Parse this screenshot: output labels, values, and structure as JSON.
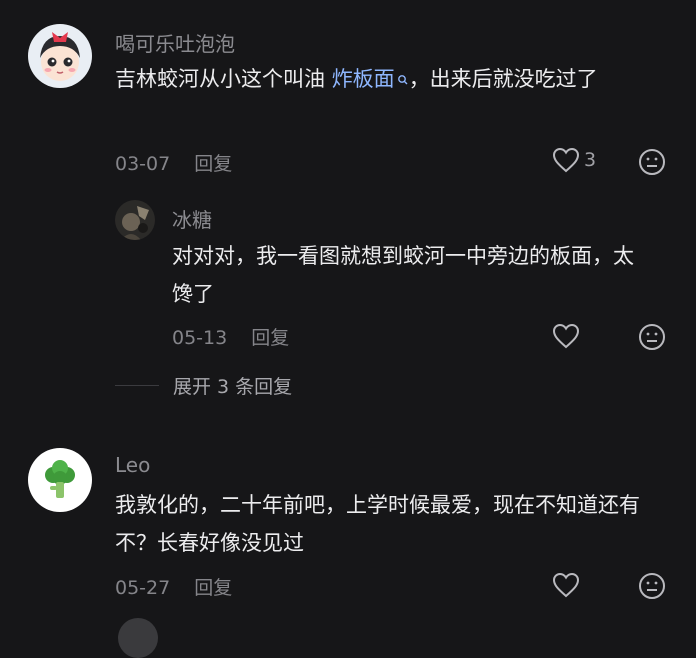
{
  "comments": [
    {
      "username": "喝可乐吐泡泡",
      "text_before": "吉林蛟河从小这个叫油 ",
      "keyword": "炸板面",
      "text_after": "，出来后就没吃过了",
      "date": "03-07",
      "reply_label": "回复",
      "likes": "3",
      "replies": [
        {
          "username": "冰糖",
          "text": "对对对，我一看图就想到蛟河一中旁边的板面，太馋了",
          "date": "05-13",
          "reply_label": "回复"
        }
      ],
      "expand_label": "展开 3 条回复"
    },
    {
      "username": "Leo",
      "text": "我敦化的，二十年前吧，上学时候最爱，现在不知道还有不？长春好像没见过",
      "date": "05-27",
      "reply_label": "回复"
    }
  ],
  "icons": {
    "like": "heart-outline-icon",
    "emoji": "neutral-face-icon",
    "keyword_search": "search-icon"
  },
  "colors": {
    "background": "#161618",
    "keyword": "#8fb7ff",
    "secondary_text": "#85858a"
  }
}
